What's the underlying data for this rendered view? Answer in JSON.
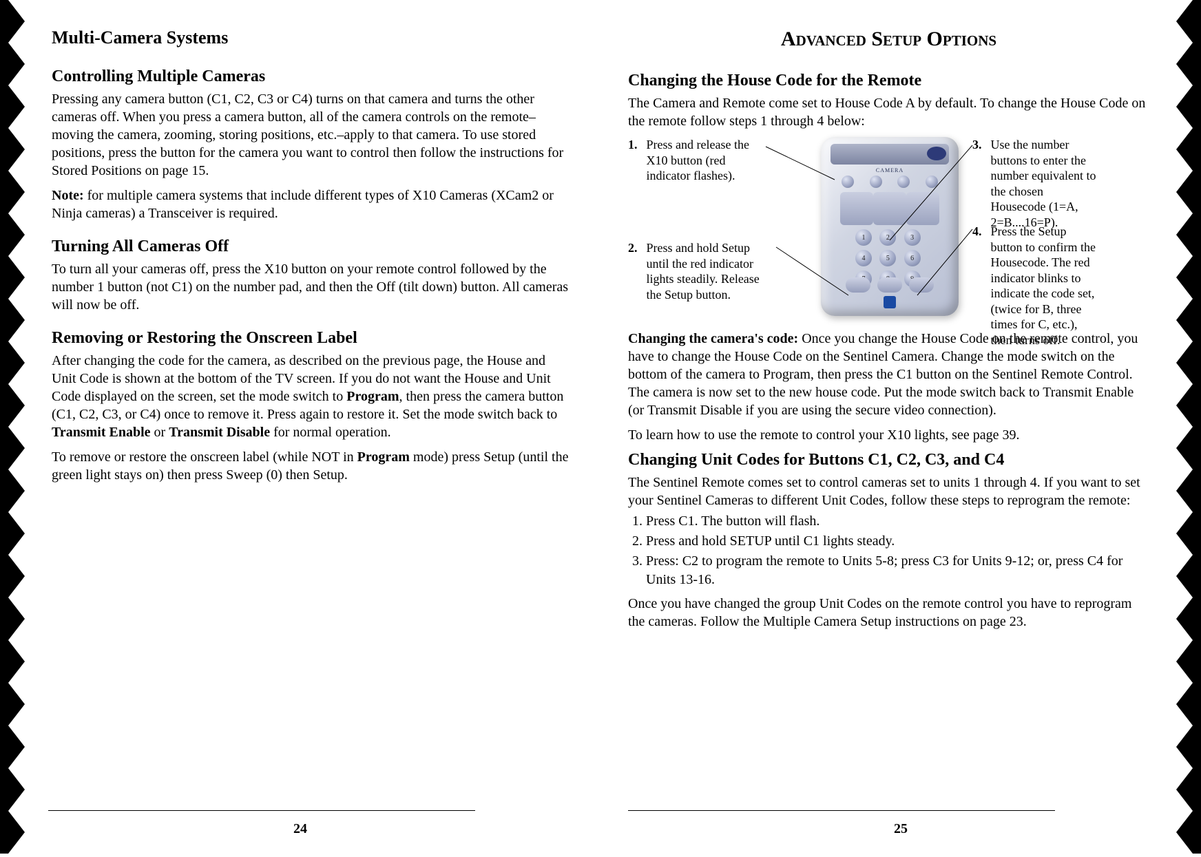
{
  "left": {
    "sectionTitle": "Multi-Camera Systems",
    "h1": "Controlling Multiple Cameras",
    "p1": "Pressing any camera button (C1, C2, C3 or C4) turns on that camera and turns the other cameras off. When you press a camera button, all of the camera controls on the remote– moving the camera, zooming, storing positions, etc.–apply to that camera. To use stored positions, press the button for the camera you want to control then follow the instructions for Stored Positions on page 15.",
    "noteLabel": "Note:",
    "p2": " for multiple camera systems that include different types of X10 Cameras (XCam2 or Ninja cameras) a Transceiver is required.",
    "h2": "Turning All Cameras Off",
    "p3": "To turn all your cameras off, press the X10 button on your remote control followed by the number 1 button (not C1) on the number pad, and then the Off (tilt down) button.  All cameras will now be off.",
    "h3": "Removing or Restoring the Onscreen Label",
    "p4a": "After changing the code for the camera, as described on the previous page, the House and Unit Code is shown at the bottom of the TV screen. If you do not want the House and Unit Code displayed on the screen, set the mode switch to ",
    "b1": "Program",
    "p4b": ", then press the camera button (C1, C2, C3, or C4) once to remove it. Press again to restore it. Set the mode switch back to ",
    "b2": "Transmit Enable",
    "p4c": " or ",
    "b3": "Transmit Disable",
    "p4d": " for normal operation.",
    "p5a": "To remove or restore the onscreen label (while NOT in ",
    "b4": "Program",
    "p5b": " mode) press Setup (until the green light stays on) then press Sweep (0) then Setup.",
    "pageNumber": "24"
  },
  "right": {
    "pageHeading": "Advanced Setup Options",
    "h1": "Changing the House Code for the Remote",
    "p1": "The Camera and Remote come set to House Code A by default. To change the House Code on the remote follow steps 1 through 4 below:",
    "step1num": "1.",
    "step1": "Press and release the X10 button (red indicator flashes).",
    "step2num": "2.",
    "step2": "Press and hold Setup until the red indicator lights steadily. Release the Setup button.",
    "step3num": "3.",
    "step3": "Use the number buttons to enter the number equiva­lent to the chosen Housecode  (1=A, 2=B....16=P).",
    "step4num": "4.",
    "step4": "Press the Setup button to confirm the Housecode. The red indicator blinks to indicate the code set, (twice for B, three times for C, etc.), then turns off.",
    "p2label": "Changing the camera's code:",
    "p2": " Once you change the House Code on the remote control, you have to change the House Code on the Sentinel Camera. Change the mode switch on the bottom of the camera to Program, then press the C1 button on the Sentinel Remote Control. The camera is now set to the new house code. Put the mode switch back to Transmit Enable (or Transmit Disable if you are using the secure video connection).",
    "p3": "To learn how to use the remote to control your X10 lights, see page 39.",
    "h2": "Changing Unit Codes for Buttons C1, C2, C3, and C4",
    "p4": "The Sentinel Remote comes set to control cameras set to units 1 through 4. If you want to set your Sentinel Cameras to different Unit Codes, follow these steps to reprogram the remote:",
    "ol1": "Press C1. The button will flash.",
    "ol2": "Press and hold SETUP until C1 lights steady.",
    "ol3": "Press: C2 to program the remote to Units 5-8; press C3 for Units 9-12; or, press C4 for Units 13-16.",
    "p5": "Once you have changed the group Unit Codes on the remote control you have to reprogram the cameras. Follow the Multiple Camera Setup instructions on page 23.",
    "pageNumber": "25"
  }
}
